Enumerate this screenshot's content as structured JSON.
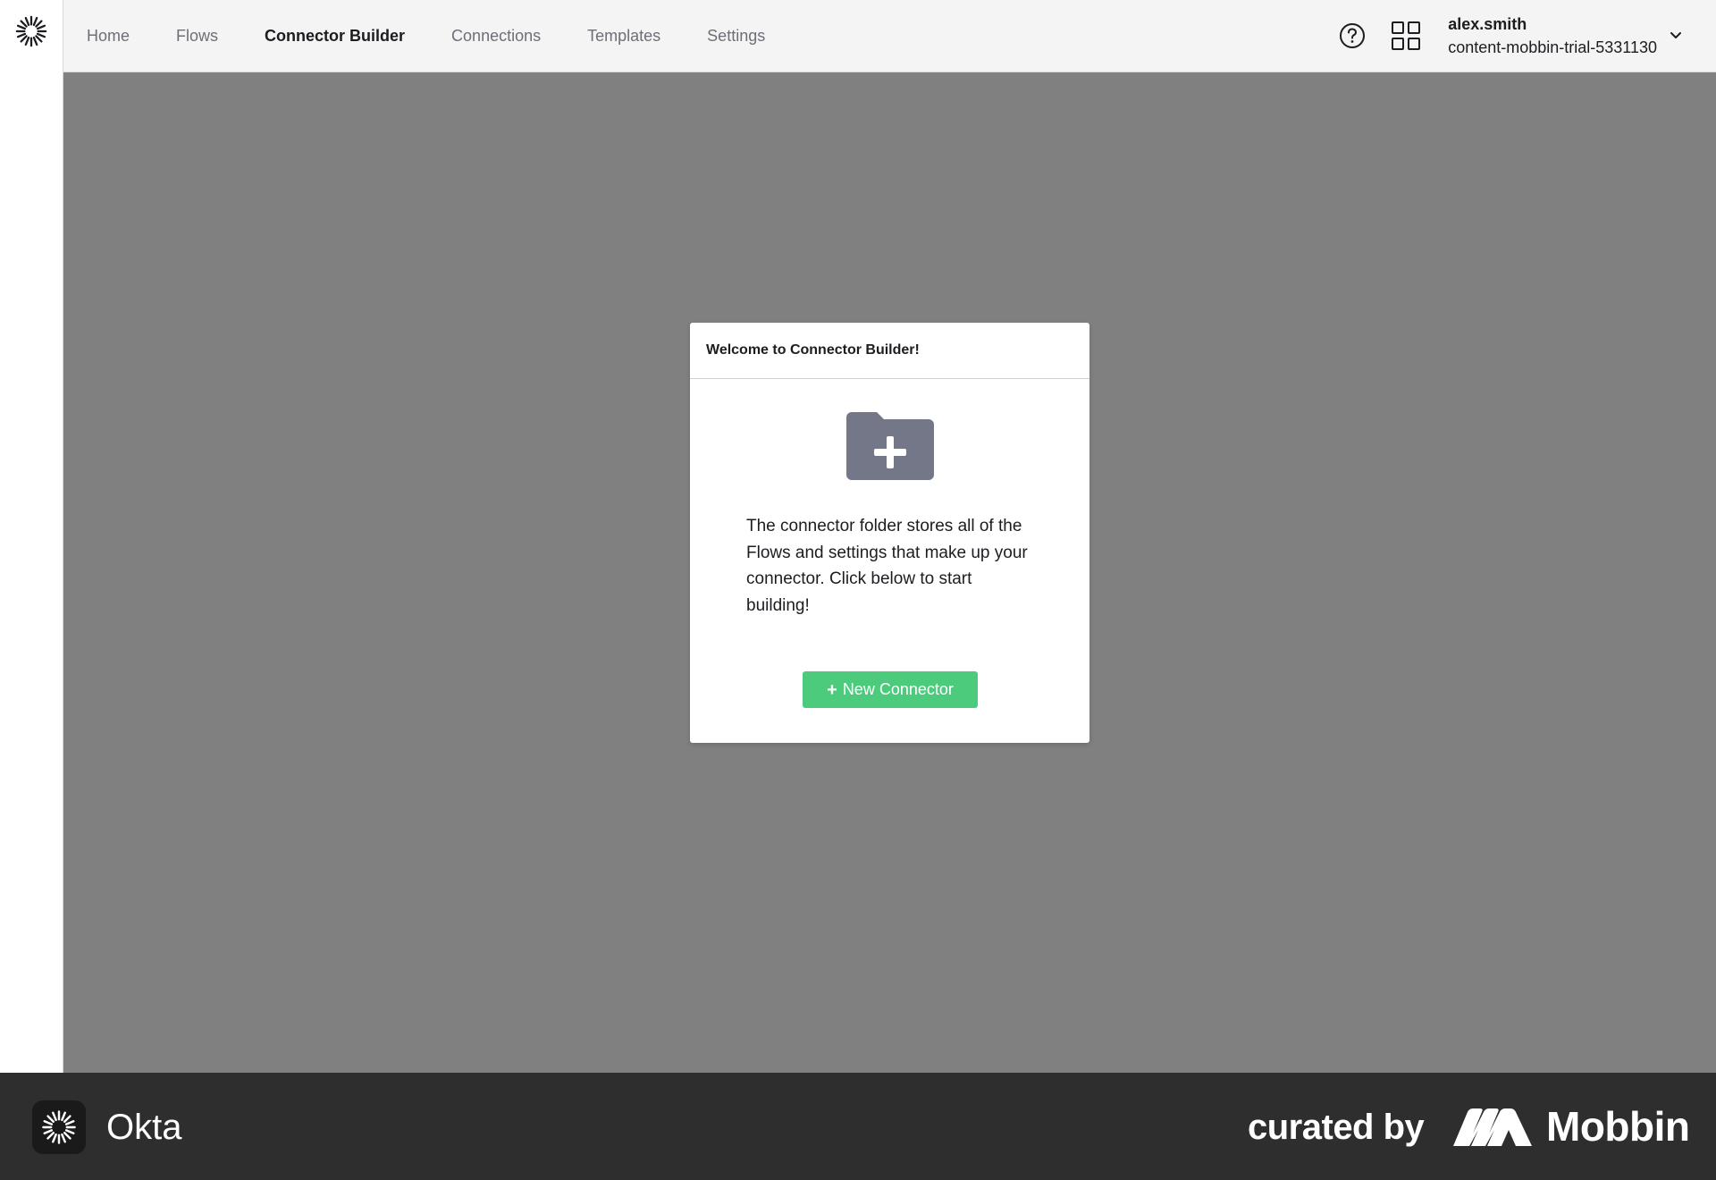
{
  "nav": {
    "items": [
      {
        "label": "Home"
      },
      {
        "label": "Flows"
      },
      {
        "label": "Connector Builder"
      },
      {
        "label": "Connections"
      },
      {
        "label": "Templates"
      },
      {
        "label": "Settings"
      }
    ],
    "active": "Connector Builder"
  },
  "header": {
    "help_icon": "question-circle-icon",
    "apps_icon": "grid-icon",
    "user_name": "alex.smith",
    "user_org": "content-mobbin-trial-5331130"
  },
  "modal": {
    "title": "Welcome to Connector Builder!",
    "icon": "folder-plus-icon",
    "body": "The connector folder stores all of the Flows and settings that make up your connector. Click below to start building!",
    "button_plus": "+",
    "button_label": "New Connector"
  },
  "footer": {
    "brand": "Okta",
    "curated": "curated by",
    "mobbin": "Mobbin"
  },
  "colors": {
    "overlay": "#808080",
    "button": "#4ccb7d",
    "folder": "#737788",
    "footer": "#2e2e2e"
  }
}
